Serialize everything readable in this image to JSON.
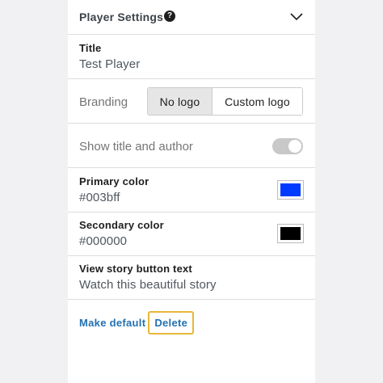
{
  "header": {
    "title": "Player Settings",
    "help_icon": "help-circle-icon",
    "help_glyph": "?",
    "collapse_icon": "chevron-down-icon"
  },
  "fields": {
    "title": {
      "label": "Title",
      "value": "Test Player"
    },
    "branding": {
      "label": "Branding",
      "options": [
        "No logo",
        "Custom logo"
      ],
      "selected": "No logo"
    },
    "show_title_author": {
      "label": "Show title and author",
      "enabled": true
    },
    "primary_color": {
      "label": "Primary color",
      "value": "#003bff",
      "swatch": "#003bff"
    },
    "secondary_color": {
      "label": "Secondary color",
      "value": "#000000",
      "swatch": "#000000"
    },
    "story_button": {
      "label": "View story button text",
      "value": "Watch this beautiful story"
    }
  },
  "actions": {
    "make_default": "Make default",
    "delete": "Delete"
  },
  "colors": {
    "link": "#2271b1",
    "focus_ring": "#e8b73a",
    "background": "#f1f1f3"
  }
}
